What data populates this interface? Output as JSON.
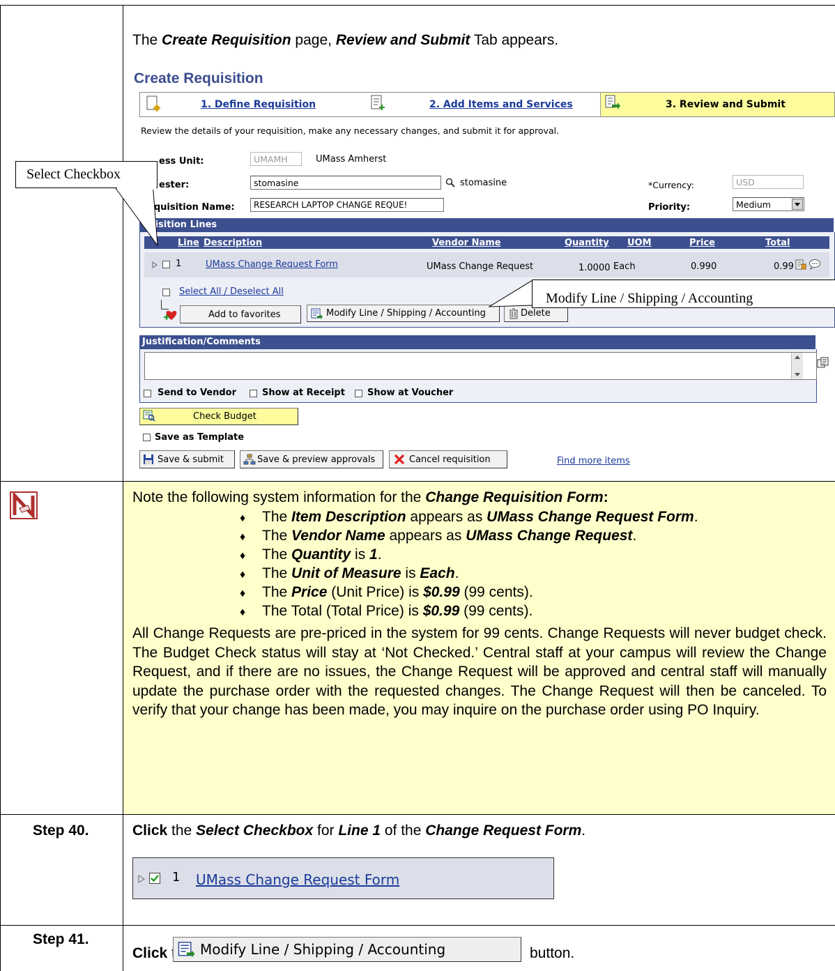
{
  "intro": {
    "prefix": "The ",
    "page": "Create Requisition",
    "mid1": " page, ",
    "tab": "Review and Submit",
    "suffix": " Tab appears."
  },
  "screen": {
    "title": "Create Requisition",
    "steps": [
      {
        "label": "1. Define Requisition"
      },
      {
        "label": "2. Add Items and Services"
      },
      {
        "label": "3. Review and Submit"
      }
    ],
    "review_text": "Review the details of your requisition, make any necessary changes, and submit it for approval.",
    "business_unit_label": "ess Unit:",
    "business_unit_value": "UMAMH",
    "business_unit_name": "UMass Amherst",
    "requester_label": "ester:",
    "requester_value": "stomasine",
    "requester_name": "stomasine",
    "currency_label": "*Currency:",
    "currency_value": "USD",
    "req_name_label": "equisition Name:",
    "req_name_value": "RESEARCH LAPTOP CHANGE REQUE!",
    "priority_label": "Priority:",
    "priority_value": "Medium",
    "lines_bar": "quisition Lines",
    "columns": [
      "Line",
      "Description",
      "Vendor Name",
      "Quantity",
      "UOM",
      "Price",
      "Total"
    ],
    "row": {
      "line": "1",
      "description": "UMass Change Request Form",
      "vendor": "UMass Change Request",
      "quantity": "1.0000",
      "uom": "Each",
      "price": "0.990",
      "total": "0.99"
    },
    "select_all": "Select All / Deselect All",
    "add_favorites": "Add to favorites",
    "modify_btn": "Modify Line / Shipping / Accounting",
    "delete_btn": "Delete",
    "justification_bar": "Justification/Comments",
    "send_vendor": "Send to Vendor",
    "show_receipt": "Show at Receipt",
    "show_voucher": "Show at Voucher",
    "check_budget": "Check Budget",
    "save_template": "Save as Template",
    "save_submit": "Save & submit",
    "save_preview": "Save & preview approvals",
    "cancel_req": "Cancel requisition",
    "find_more": "Find more items"
  },
  "callouts": {
    "select_checkbox": "Select Checkbox",
    "modify_line": "Modify Line / Shipping / Accounting"
  },
  "note": {
    "head_prefix": "Note the following system information for the ",
    "head_bold": "Change Requisition Form",
    "head_suffix": ":",
    "bullets": [
      {
        "a": "The ",
        "b": "Item Description",
        "c": " appears as ",
        "d": "UMass Change Request Form",
        "e": "."
      },
      {
        "a": "The ",
        "b": "Vendor Name",
        "c": " appears as ",
        "d": "UMass Change Request",
        "e": "."
      },
      {
        "a": "The ",
        "b": "Quantity",
        "c": " is ",
        "d": "1",
        "e": "."
      },
      {
        "a": "The ",
        "b": "Unit of Measure",
        "c": " is ",
        "d": "Each",
        "e": "."
      },
      {
        "a": "The ",
        "b": "Price",
        "c": " (Unit Price) is ",
        "d": "$0.99",
        "e": " (99 cents)."
      },
      {
        "a": "The Total (Total Price) is ",
        "b": "",
        "c": "",
        "d": "$0.99",
        "e": " (99 cents)."
      }
    ],
    "paragraph": "All Change Requests are pre-priced in the system for 99 cents. Change Requests will never budget check. The Budget Check status will stay at ‘Not Checked.’ Central staff at your campus will review the Change Request, and if there are no issues, the Change Request will be approved and central staff will manually update the purchase order with the requested changes. The Change Request will then be canceled. To verify that your change has been made, you may inquire on the purchase order using PO Inquiry."
  },
  "step40": {
    "label": "Step 40.",
    "click": "Click",
    "t1": " the ",
    "b1": "Select Checkbox",
    "t2": " for ",
    "b2": "Line 1",
    "t3": " of the ",
    "b3": "Change Request Form",
    "t4": ".",
    "snippet_line": "1",
    "snippet_link": "UMass Change Request Form"
  },
  "step41": {
    "label": "Step 41.",
    "click": "Click",
    "t1": " the ",
    "button": "Modify Line / Shipping / Accounting",
    "t2": "button."
  },
  "colors": {
    "ps_blue": "#3c4f8f",
    "link_blue": "#1b3a9a",
    "note_yellow": "#ffffcc",
    "active_step": "#fcfc9c"
  }
}
